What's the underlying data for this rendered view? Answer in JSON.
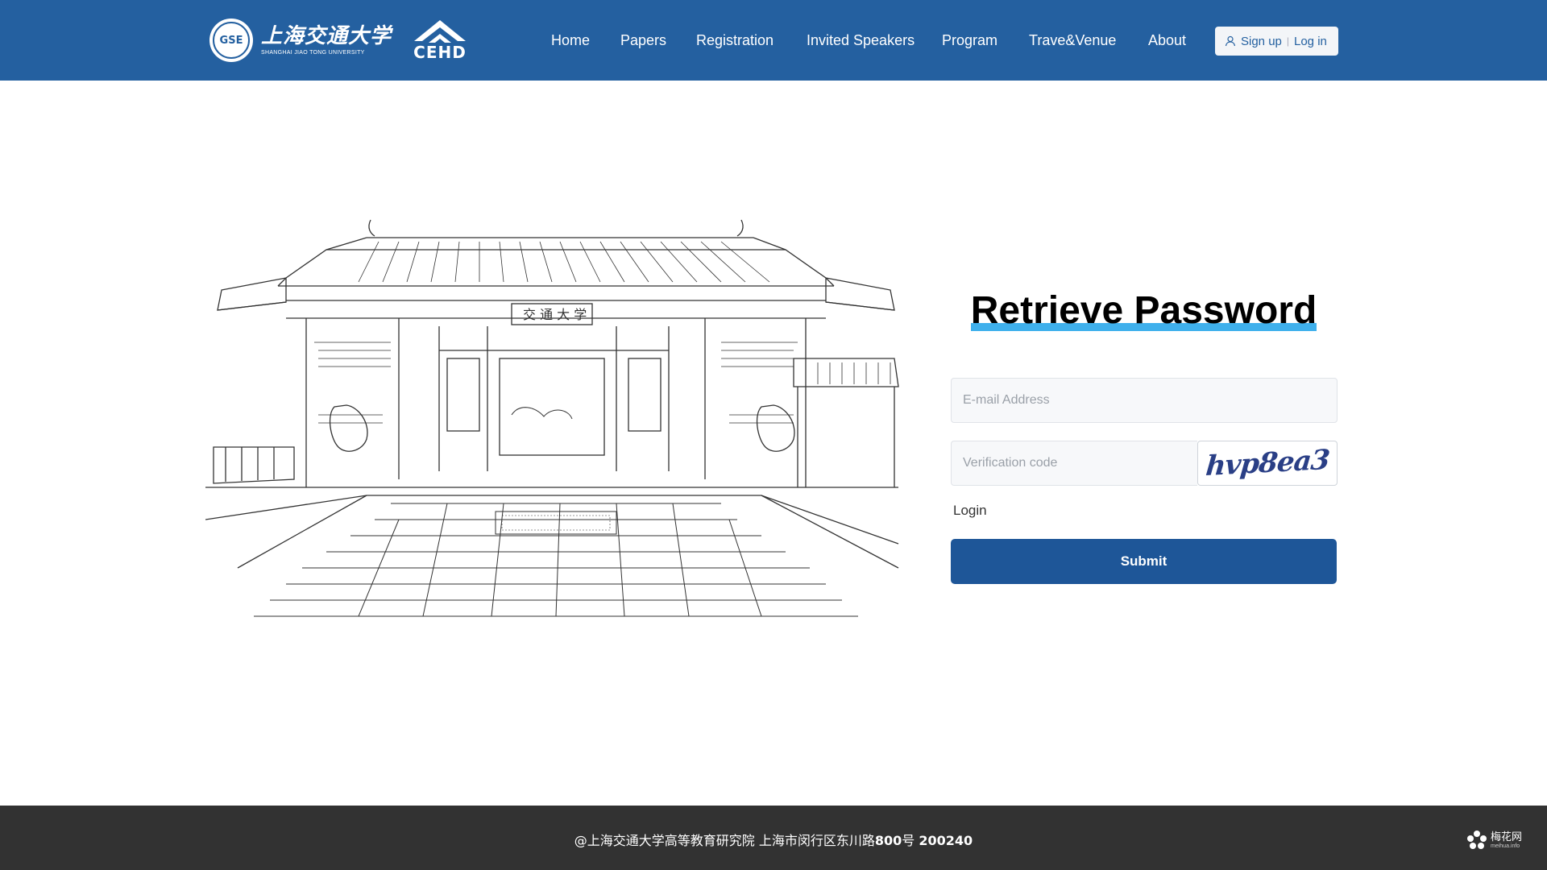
{
  "colors": {
    "brand": "#2460a0",
    "accent": "#3fb0ec",
    "submit": "#1e5698",
    "footer": "#323232"
  },
  "header": {
    "logo": {
      "seal_text": "GSE",
      "seal_year": "1896",
      "cn_name": "上海交通大学",
      "en_name": "SHANGHAI JIAO TONG UNIVERSITY",
      "cehd": "CEHD"
    },
    "nav": [
      "Home",
      "Papers",
      "Registration",
      "Invited Speakers",
      "Program",
      "Trave&Venue",
      "About"
    ],
    "auth": {
      "icon": "user-icon",
      "signup": "Sign up",
      "login": "Log in"
    }
  },
  "form": {
    "title": "Retrieve Password",
    "email_placeholder": "E-mail Address",
    "code_placeholder": "Verification code",
    "captcha": "hvp8ea3",
    "login_link": "Login",
    "submit": "Submit"
  },
  "footer": {
    "text": "@上海交通大学高等教育研究院  上海市闵行区东川路",
    "number": "800",
    "suffix": "号  ",
    "zip": "200240"
  },
  "watermark": {
    "cn": "梅花网",
    "en": "meihua.info",
    "icon": "flower-icon"
  }
}
